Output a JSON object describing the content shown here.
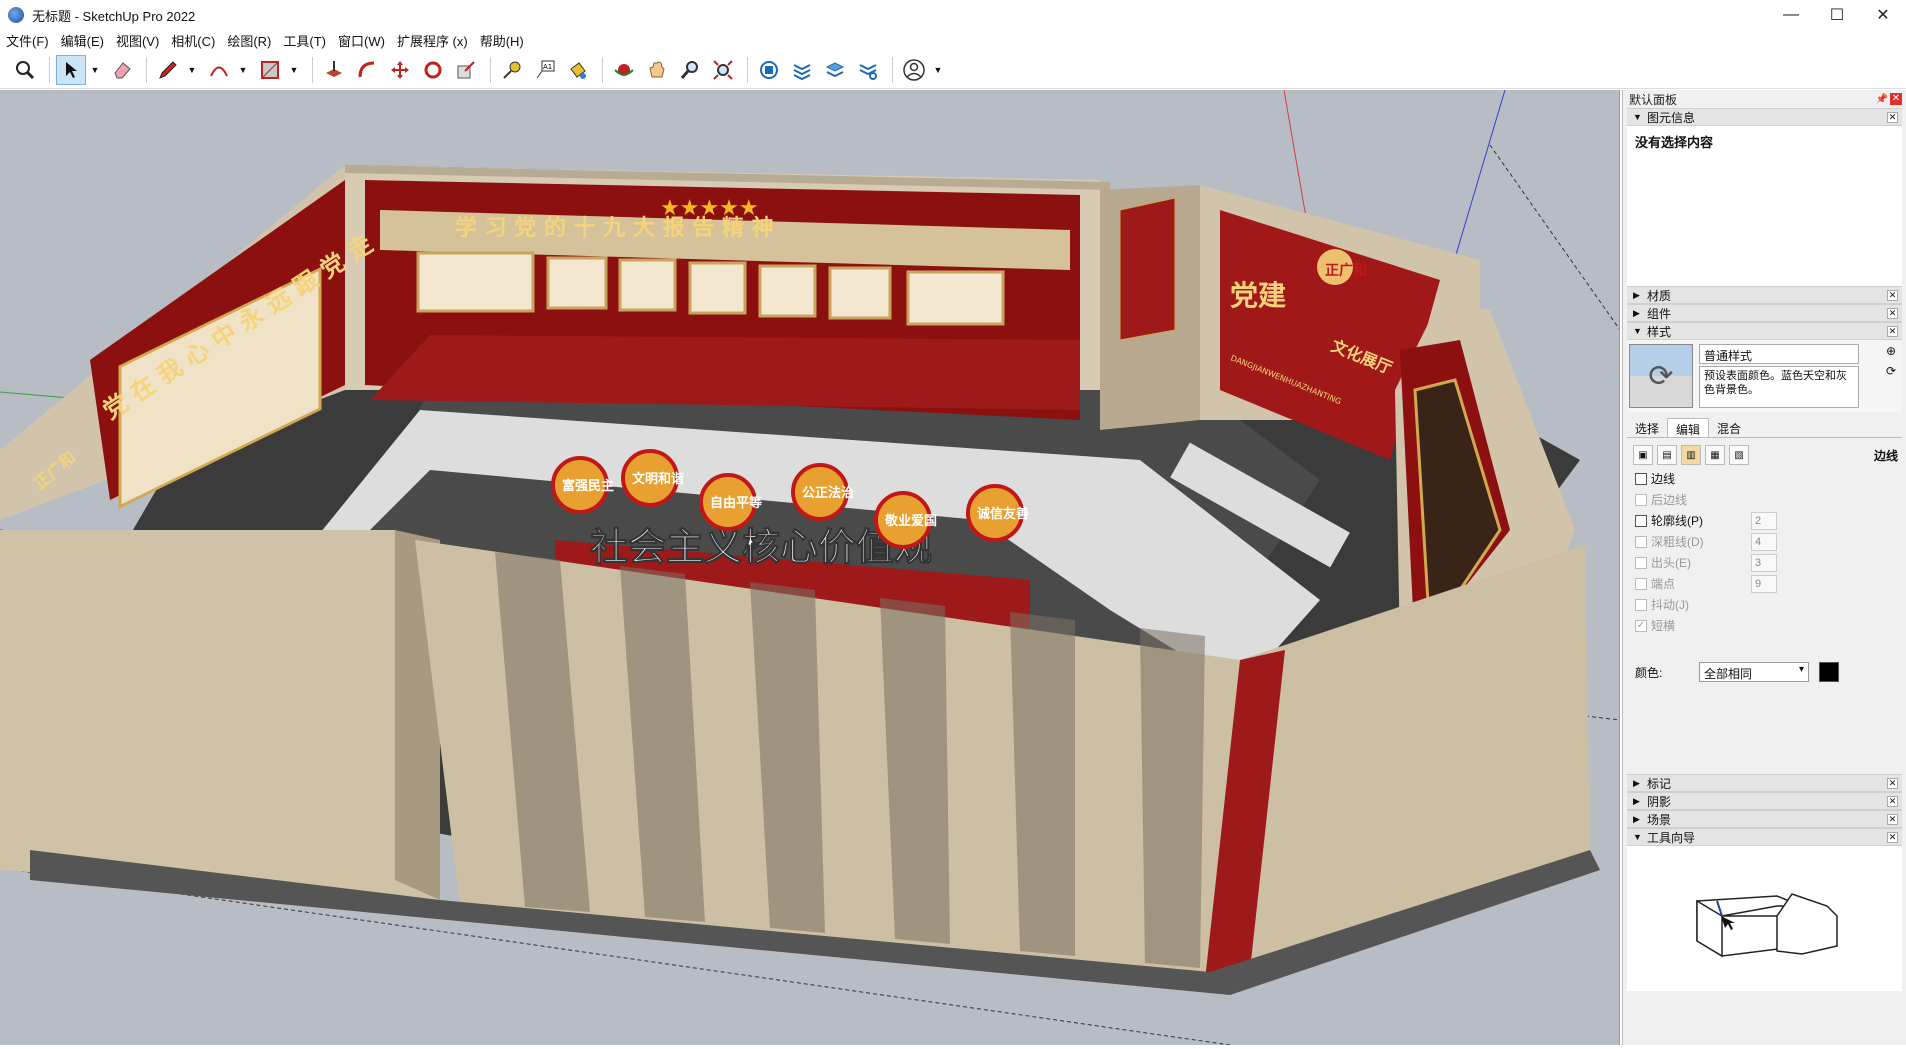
{
  "window": {
    "title": "无标题 - SketchUp Pro 2022",
    "min": "—",
    "max": "☐",
    "close": "✕"
  },
  "menu": [
    "文件(F)",
    "编辑(E)",
    "视图(V)",
    "相机(C)",
    "绘图(R)",
    "工具(T)",
    "窗口(W)",
    "扩展程序 (x)",
    "帮助(H)"
  ],
  "toolbar": {
    "tools": [
      "search-icon",
      "select-icon",
      "eraser-icon",
      "pencil-icon",
      "arc-icon",
      "shape-icon",
      "pushpull-icon",
      "followme-icon",
      "move-icon",
      "rotate-icon",
      "scale-icon",
      "tape-icon",
      "text-icon",
      "paint-icon",
      "orbit-icon",
      "pan-icon",
      "zoom-icon",
      "zoom-extents-icon",
      "warehouse-icon",
      "extension-icon",
      "layers-icon",
      "settings-icon",
      "account-icon"
    ]
  },
  "scene": {
    "back_banner": "学 习 党 的 十 九 大 报 告 精 神",
    "left_banner": "党 在 我 心 中   永 远 跟 党 走",
    "center_sign": "社会主义核心价值观",
    "circles": [
      "富强民主",
      "文明和谐",
      "自由平等",
      "公正法治",
      "敬业爱国",
      "诚信友善"
    ],
    "right_title": "党建",
    "right_subtitle": "文化展厅",
    "right_pinyin": "DANGJIANWENHUAZHANTING",
    "brand": "正广和",
    "brand_left": "正广和"
  },
  "tray": {
    "title": "默认面板",
    "entity_info": {
      "label": "图元信息",
      "content": "没有选择内容"
    },
    "sections_collapsed_top": [
      "材质",
      "组件"
    ],
    "styles": {
      "label": "样式",
      "name": "普通样式",
      "desc": "预设表面颜色。蓝色天空和灰色背景色。",
      "tabs": [
        "选择",
        "编辑",
        "混合"
      ],
      "edit_label": "边线",
      "options": [
        {
          "label": "边线",
          "checked": false,
          "disabled": false
        },
        {
          "label": "后边线",
          "checked": false,
          "disabled": true
        },
        {
          "label": "轮廓线(P)",
          "checked": false,
          "disabled": false,
          "value": "2"
        },
        {
          "label": "深粗线(D)",
          "checked": false,
          "disabled": true,
          "value": "4"
        },
        {
          "label": "出头(E)",
          "checked": false,
          "disabled": true,
          "value": "3"
        },
        {
          "label": "端点",
          "checked": false,
          "disabled": true,
          "value": "9"
        },
        {
          "label": "抖动(J)",
          "checked": false,
          "disabled": true
        },
        {
          "label": "短横",
          "checked": true,
          "disabled": true
        }
      ],
      "color_label": "颜色:",
      "color_value": "全部相同"
    },
    "sections_collapsed_bottom": [
      "标记",
      "阴影",
      "场景"
    ],
    "instructor": {
      "label": "工具向导"
    }
  }
}
